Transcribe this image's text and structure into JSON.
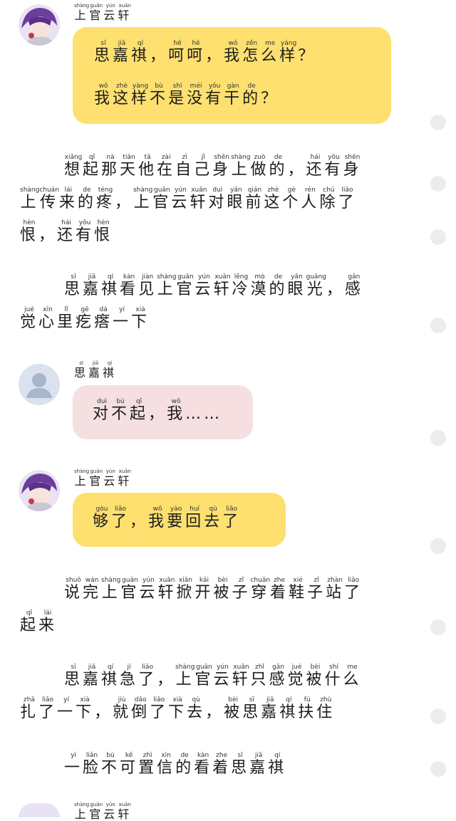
{
  "speakers": {
    "shangguan": [
      {
        "c": "上",
        "p": "shàng"
      },
      {
        "c": "官",
        "p": "guān"
      },
      {
        "c": "云",
        "p": "yún"
      },
      {
        "c": "轩",
        "p": "xuān"
      }
    ],
    "siji": [
      {
        "c": "思",
        "p": "sī"
      },
      {
        "c": "嘉",
        "p": "jiā"
      },
      {
        "c": "祺",
        "p": "qí"
      }
    ]
  },
  "messages": {
    "m1_line1": [
      {
        "c": "思",
        "p": "sī"
      },
      {
        "c": "嘉",
        "p": "jiā"
      },
      {
        "c": "祺",
        "p": "qí"
      },
      {
        "c": "，",
        "p": ""
      },
      {
        "c": "呵",
        "p": "hē"
      },
      {
        "c": "呵",
        "p": "hē"
      },
      {
        "c": "，",
        "p": ""
      },
      {
        "c": "我",
        "p": "wǒ"
      },
      {
        "c": "怎",
        "p": "zěn"
      },
      {
        "c": "么",
        "p": "me"
      },
      {
        "c": "样",
        "p": "yàng"
      },
      {
        "c": "？",
        "p": ""
      }
    ],
    "m1_line2": [
      {
        "c": "我",
        "p": "wǒ"
      },
      {
        "c": "这",
        "p": "zhè"
      },
      {
        "c": "样",
        "p": "yàng"
      },
      {
        "c": "不",
        "p": "bù"
      },
      {
        "c": "是",
        "p": "shì"
      },
      {
        "c": "没",
        "p": "méi"
      },
      {
        "c": "有",
        "p": "yǒu"
      },
      {
        "c": "干",
        "p": "gàn"
      },
      {
        "c": "的",
        "p": "de"
      },
      {
        "c": "？",
        "p": ""
      }
    ],
    "m2": [
      {
        "c": "对",
        "p": "duì"
      },
      {
        "c": "不",
        "p": "bù"
      },
      {
        "c": "起",
        "p": "qǐ"
      },
      {
        "c": "，",
        "p": ""
      },
      {
        "c": "我",
        "p": "wǒ"
      },
      {
        "c": "……",
        "p": ""
      }
    ],
    "m3": [
      {
        "c": "够",
        "p": "gòu"
      },
      {
        "c": "了",
        "p": "liǎo"
      },
      {
        "c": "，",
        "p": ""
      },
      {
        "c": "我",
        "p": "wǒ"
      },
      {
        "c": "要",
        "p": "yào"
      },
      {
        "c": "回",
        "p": "huí"
      },
      {
        "c": "去",
        "p": "qù"
      },
      {
        "c": "了",
        "p": "liǎo"
      }
    ]
  },
  "narration": {
    "p1_l1": [
      {
        "c": "想",
        "p": "xiǎng"
      },
      {
        "c": "起",
        "p": "qǐ"
      },
      {
        "c": "那",
        "p": "nà"
      },
      {
        "c": "天",
        "p": "tiān"
      },
      {
        "c": "他",
        "p": "tā"
      },
      {
        "c": "在",
        "p": "zài"
      },
      {
        "c": "自",
        "p": "zì"
      },
      {
        "c": "己",
        "p": "jǐ"
      },
      {
        "c": "身",
        "p": "shēn"
      },
      {
        "c": "上",
        "p": "shàng"
      },
      {
        "c": "做",
        "p": "zuò"
      },
      {
        "c": "的",
        "p": "de"
      },
      {
        "c": "，",
        "p": ""
      },
      {
        "c": "还",
        "p": "hái"
      },
      {
        "c": "有",
        "p": "yǒu"
      },
      {
        "c": "身",
        "p": "shēn"
      }
    ],
    "p1_l2": [
      {
        "c": "上",
        "p": "shàng"
      },
      {
        "c": "传",
        "p": "chuán"
      },
      {
        "c": "来",
        "p": "lái"
      },
      {
        "c": "的",
        "p": "de"
      },
      {
        "c": "疼",
        "p": "téng"
      },
      {
        "c": "，",
        "p": ""
      },
      {
        "c": "上",
        "p": "shàng"
      },
      {
        "c": "官",
        "p": "guān"
      },
      {
        "c": "云",
        "p": "yún"
      },
      {
        "c": "轩",
        "p": "xuān"
      },
      {
        "c": "对",
        "p": "duì"
      },
      {
        "c": "眼",
        "p": "yǎn"
      },
      {
        "c": "前",
        "p": "qián"
      },
      {
        "c": "这",
        "p": "zhè"
      },
      {
        "c": "个",
        "p": "gè"
      },
      {
        "c": "人",
        "p": "rén"
      },
      {
        "c": "除",
        "p": "chú"
      },
      {
        "c": "了",
        "p": "liǎo"
      }
    ],
    "p1_l3": [
      {
        "c": "恨",
        "p": "hèn"
      },
      {
        "c": "，",
        "p": ""
      },
      {
        "c": "还",
        "p": "hái"
      },
      {
        "c": "有",
        "p": "yǒu"
      },
      {
        "c": "恨",
        "p": "hèn"
      }
    ],
    "p2_l1": [
      {
        "c": "思",
        "p": "sī"
      },
      {
        "c": "嘉",
        "p": "jiā"
      },
      {
        "c": "祺",
        "p": "qí"
      },
      {
        "c": "看",
        "p": "kàn"
      },
      {
        "c": "见",
        "p": "jiàn"
      },
      {
        "c": "上",
        "p": "shàng"
      },
      {
        "c": "官",
        "p": "guān"
      },
      {
        "c": "云",
        "p": "yún"
      },
      {
        "c": "轩",
        "p": "xuān"
      },
      {
        "c": "冷",
        "p": "lěng"
      },
      {
        "c": "漠",
        "p": "mò"
      },
      {
        "c": "的",
        "p": "de"
      },
      {
        "c": "眼",
        "p": "yǎn"
      },
      {
        "c": "光",
        "p": "guāng"
      },
      {
        "c": "，",
        "p": ""
      },
      {
        "c": "感",
        "p": "gǎn"
      }
    ],
    "p2_l2": [
      {
        "c": "觉",
        "p": "jué"
      },
      {
        "c": "心",
        "p": "xīn"
      },
      {
        "c": "里",
        "p": "lǐ"
      },
      {
        "c": "疙",
        "p": "gē"
      },
      {
        "c": "瘩",
        "p": "dá"
      },
      {
        "c": "一",
        "p": "yí"
      },
      {
        "c": "下",
        "p": "xià"
      }
    ],
    "p3_l1": [
      {
        "c": "说",
        "p": "shuō"
      },
      {
        "c": "完",
        "p": "wán"
      },
      {
        "c": "上",
        "p": "shàng"
      },
      {
        "c": "官",
        "p": "guān"
      },
      {
        "c": "云",
        "p": "yún"
      },
      {
        "c": "轩",
        "p": "xuān"
      },
      {
        "c": "掀",
        "p": "xiān"
      },
      {
        "c": "开",
        "p": "kāi"
      },
      {
        "c": "被",
        "p": "bèi"
      },
      {
        "c": "子",
        "p": "zǐ"
      },
      {
        "c": "穿",
        "p": "chuān"
      },
      {
        "c": "着",
        "p": "zhe"
      },
      {
        "c": "鞋",
        "p": "xié"
      },
      {
        "c": "子",
        "p": "zǐ"
      },
      {
        "c": "站",
        "p": "zhàn"
      },
      {
        "c": "了",
        "p": "liǎo"
      }
    ],
    "p3_l2": [
      {
        "c": "起",
        "p": "qǐ"
      },
      {
        "c": "来",
        "p": "lái"
      }
    ],
    "p4_l1": [
      {
        "c": "思",
        "p": "sī"
      },
      {
        "c": "嘉",
        "p": "jiā"
      },
      {
        "c": "祺",
        "p": "qí"
      },
      {
        "c": "急",
        "p": "jí"
      },
      {
        "c": "了",
        "p": "liǎo"
      },
      {
        "c": "，",
        "p": ""
      },
      {
        "c": "上",
        "p": "shàng"
      },
      {
        "c": "官",
        "p": "guān"
      },
      {
        "c": "云",
        "p": "yún"
      },
      {
        "c": "轩",
        "p": "xuān"
      },
      {
        "c": "只",
        "p": "zhǐ"
      },
      {
        "c": "感",
        "p": "gǎn"
      },
      {
        "c": "觉",
        "p": "jué"
      },
      {
        "c": "被",
        "p": "bèi"
      },
      {
        "c": "什",
        "p": "shí"
      },
      {
        "c": "么",
        "p": "me"
      }
    ],
    "p4_l2": [
      {
        "c": "扎",
        "p": "zhā"
      },
      {
        "c": "了",
        "p": "liǎo"
      },
      {
        "c": "一",
        "p": "yí"
      },
      {
        "c": "下",
        "p": "xià"
      },
      {
        "c": "，",
        "p": ""
      },
      {
        "c": "就",
        "p": "jiù"
      },
      {
        "c": "倒",
        "p": "dǎo"
      },
      {
        "c": "了",
        "p": "liǎo"
      },
      {
        "c": "下",
        "p": "xià"
      },
      {
        "c": "去",
        "p": "qù"
      },
      {
        "c": "，",
        "p": ""
      },
      {
        "c": "被",
        "p": "bèi"
      },
      {
        "c": "思",
        "p": "sī"
      },
      {
        "c": "嘉",
        "p": "jiā"
      },
      {
        "c": "祺",
        "p": "qí"
      },
      {
        "c": "扶",
        "p": "fú"
      },
      {
        "c": "住",
        "p": "zhù"
      }
    ],
    "p5_l1": [
      {
        "c": "一",
        "p": "yì"
      },
      {
        "c": "脸",
        "p": "liǎn"
      },
      {
        "c": "不",
        "p": "bù"
      },
      {
        "c": "可",
        "p": "kě"
      },
      {
        "c": "置",
        "p": "zhì"
      },
      {
        "c": "信",
        "p": "xìn"
      },
      {
        "c": "的",
        "p": "de"
      },
      {
        "c": "看",
        "p": "kàn"
      },
      {
        "c": "着",
        "p": "zhe"
      },
      {
        "c": "思",
        "p": "sī"
      },
      {
        "c": "嘉",
        "p": "jiā"
      },
      {
        "c": "祺",
        "p": "qí"
      }
    ]
  },
  "colors": {
    "yellow_bubble": "#fde070",
    "pink_bubble": "#f6dfe0",
    "side_dot": "#ececec"
  },
  "icons": [
    "avatar-shangguan",
    "avatar-siji-placeholder"
  ]
}
